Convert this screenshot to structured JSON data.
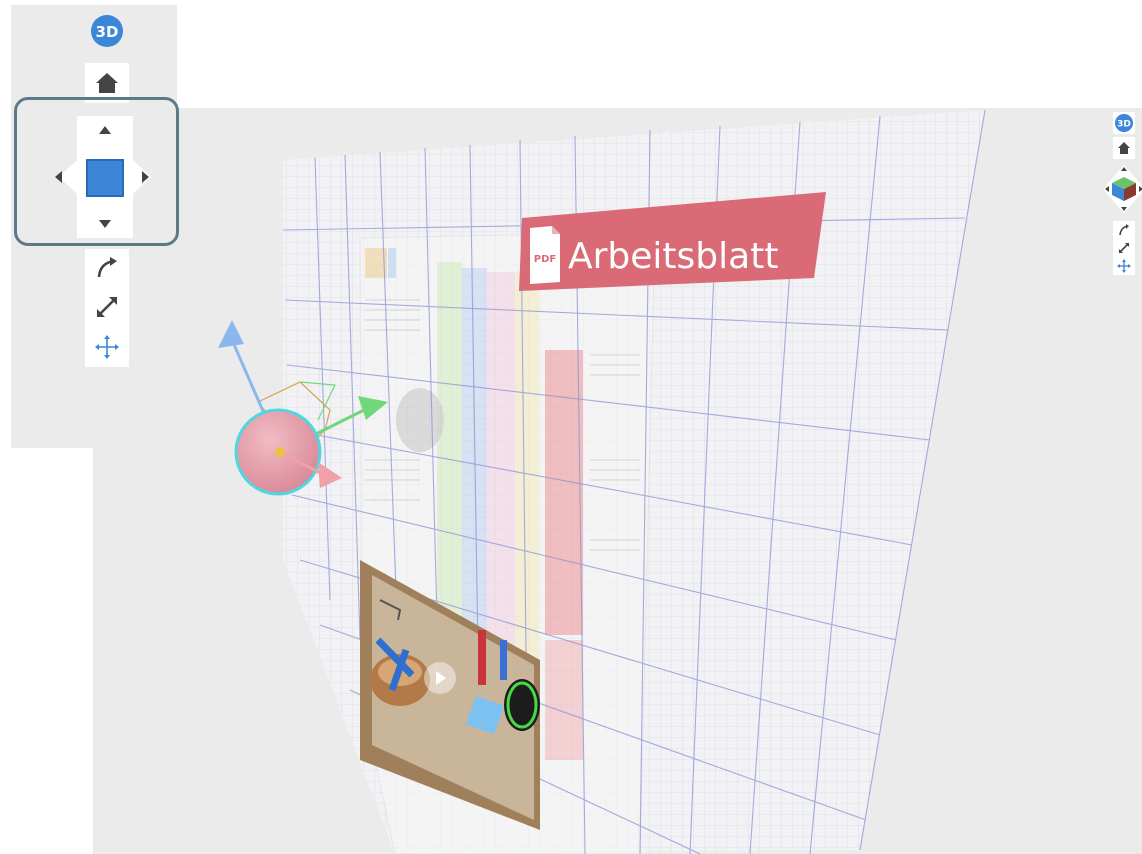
{
  "view_mode": "3D",
  "pdf_label": {
    "icon_text": "PDF",
    "title": "Arbeitsblatt",
    "color": "#d96a76"
  },
  "toolbar": {
    "buttons": [
      {
        "name": "3d-mode-button",
        "label": "3D",
        "icon": "3d-badge-icon"
      },
      {
        "name": "home-button",
        "icon": "home-icon"
      },
      {
        "name": "nav-cube",
        "icon": "cube-icon"
      },
      {
        "name": "rotate-tool-button",
        "icon": "rotate-arrow-icon"
      },
      {
        "name": "scale-tool-button",
        "icon": "diagonal-arrow-icon"
      },
      {
        "name": "move-tool-button",
        "icon": "move-cross-icon"
      }
    ]
  },
  "colors": {
    "accent_blue": "#3c86d8",
    "highlight_border": "#5d7a89",
    "grid_line": "#8a92d6",
    "gizmo_sphere": "#e69aa6",
    "gizmo_y": "#8ab8ee",
    "gizmo_x": "#6fd87a"
  }
}
